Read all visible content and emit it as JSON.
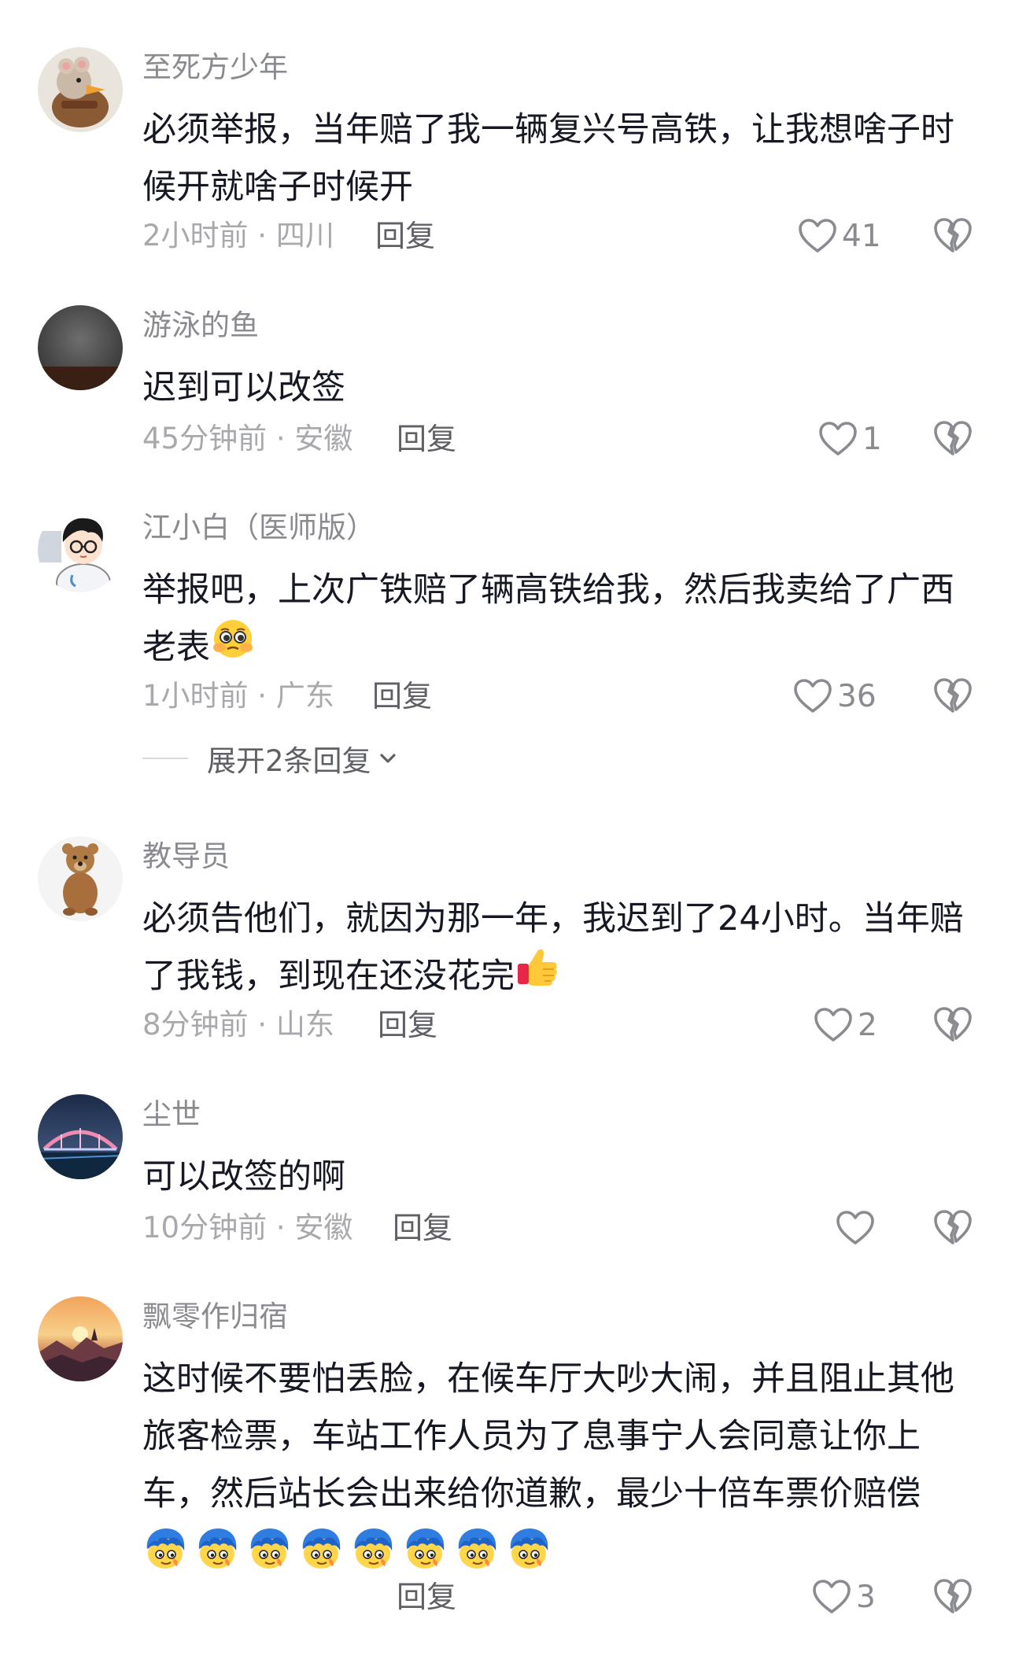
{
  "comments": [
    {
      "username": "至死方少年",
      "text": "必须举报，当年赔了我一辆复兴号高铁，让我想啥子时候开就啥子时候开",
      "meta": "2小时前 · 四川",
      "reply_label": "回复",
      "likes": "41"
    },
    {
      "username": "游泳的鱼",
      "text": "迟到可以改签",
      "meta": "45分钟前 · 安徽",
      "reply_label": "回复",
      "likes": "1"
    },
    {
      "username": "江小白（医师版）",
      "text": "举报吧，上次广铁赔了辆高铁给我，然后我卖给了广西老表",
      "meta": "1小时前 · 广东",
      "reply_label": "回复",
      "likes": "36",
      "expand_label": "展开2条回复",
      "emoji": "pleading-face-emoji"
    },
    {
      "username": "教导员",
      "text": "必须告他们，就因为那一年，我迟到了24小时。当年赔了我钱，到现在还没花完",
      "meta": "8分钟前 · 山东",
      "reply_label": "回复",
      "likes": "2",
      "emoji": "thumbs-up-emoji"
    },
    {
      "username": "尘世",
      "text": "可以改签的啊",
      "meta": "10分钟前 · 安徽",
      "reply_label": "回复",
      "likes": ""
    },
    {
      "username": "飘零作归宿",
      "text": "这时候不要怕丢脸，在候车厅大吵大闹，并且阻止其他旅客检票，车站工作人员为了息事宁人会同意让你上车，然后站长会出来给你道歉，最少十倍车票价赔偿",
      "meta": "",
      "reply_label": "回复",
      "likes": "3",
      "emoji": "blue-hair-character-emoji",
      "emoji_count": 8
    }
  ],
  "icons": {
    "like": "heart-outline-icon",
    "dislike": "broken-heart-outline-icon",
    "expand": "chevron-down-icon"
  },
  "colors": {
    "text": "#161823",
    "username": "#8a8b91",
    "meta": "#a8a9ad",
    "icon": "#8a8b91"
  }
}
